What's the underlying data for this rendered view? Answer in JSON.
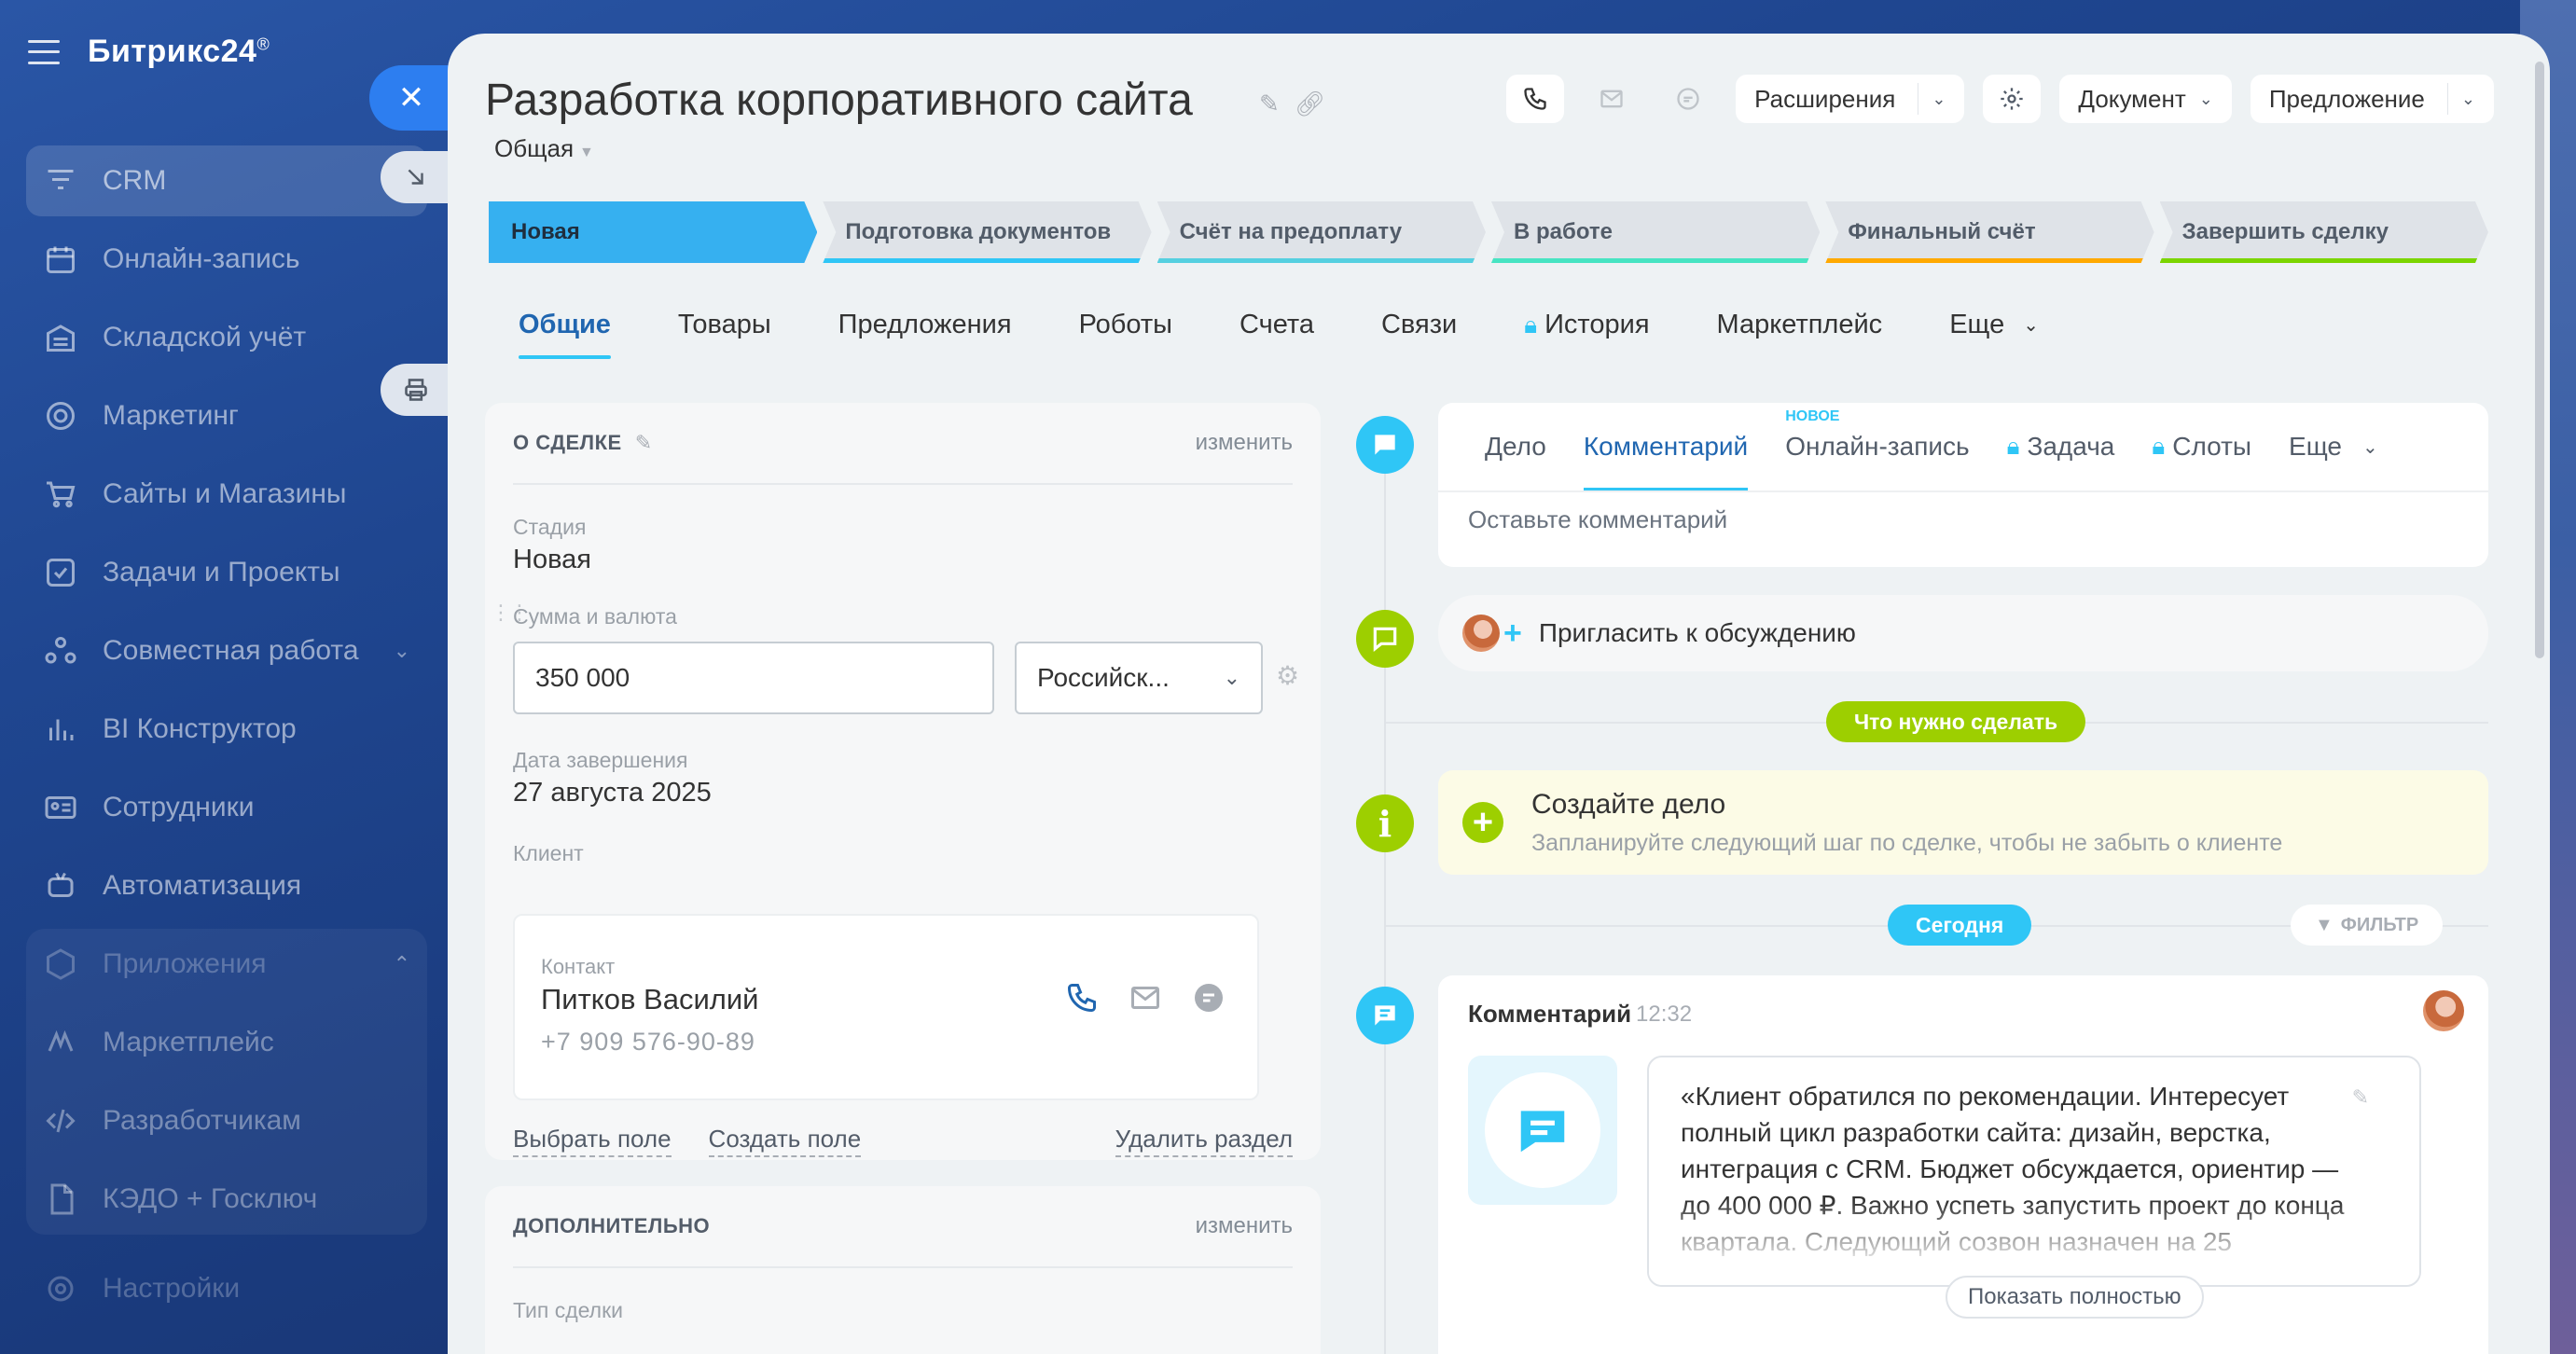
{
  "sidebar": {
    "brand": "Битрикс24",
    "brand_mark": "®",
    "items": [
      {
        "label": "CRM",
        "icon": "funnel-icon"
      },
      {
        "label": "Онлайн-запись",
        "icon": "calendar-icon"
      },
      {
        "label": "Складской учёт",
        "icon": "warehouse-icon"
      },
      {
        "label": "Маркетинг",
        "icon": "target-icon"
      },
      {
        "label": "Сайты и Магазины",
        "icon": "cart-icon"
      },
      {
        "label": "Задачи и Проекты",
        "icon": "checkbox-icon"
      },
      {
        "label": "Совместная работа",
        "icon": "collab-icon"
      },
      {
        "label": "BI Конструктор",
        "icon": "bar-chart-icon"
      },
      {
        "label": "Сотрудники",
        "icon": "id-card-icon"
      },
      {
        "label": "Автоматизация",
        "icon": "robot-icon"
      },
      {
        "label": "Приложения",
        "icon": "cube-icon"
      },
      {
        "label": "Маркетплейс",
        "icon": "market-icon"
      },
      {
        "label": "Разработчикам",
        "icon": "code-icon"
      },
      {
        "label": "КЭДО + Госключ",
        "icon": "document-icon"
      },
      {
        "label": "Настройки",
        "icon": "gear-icon"
      }
    ]
  },
  "deal": {
    "title": "Разработка корпоративного сайта",
    "category": "Общая"
  },
  "toolbar": {
    "extensions": "Расширения",
    "document": "Документ",
    "proposal": "Предложение"
  },
  "stages": [
    {
      "label": "Новая",
      "color": "#36b0f0"
    },
    {
      "label": "Подготовка документов",
      "color": "#2fc6f6"
    },
    {
      "label": "Счёт на предоплату",
      "color": "#55d0e0"
    },
    {
      "label": "В работе",
      "color": "#47e4c2"
    },
    {
      "label": "Финальный счёт",
      "color": "#ffa900"
    },
    {
      "label": "Завершить сделку",
      "color": "#7bd500"
    }
  ],
  "tabs": [
    "Общие",
    "Товары",
    "Предложения",
    "Роботы",
    "Счета",
    "Связи",
    "История",
    "Маркетплейс",
    "Еще"
  ],
  "about": {
    "header": "О СДЕЛКЕ",
    "edit": "изменить",
    "stage_label": "Стадия",
    "stage_value": "Новая",
    "amount_label": "Сумма и валюта",
    "amount_value": "350 000",
    "currency_value": "Российск...",
    "close_label": "Дата завершения",
    "close_value": "27 августа 2025",
    "client_label": "Клиент",
    "contact_kind": "Контакт",
    "contact_name": "Питков Василий",
    "contact_phone": "+7 909 576-90-89",
    "link_select": "Выбрать поле",
    "link_create": "Создать поле",
    "link_delete": "Удалить раздел"
  },
  "extra": {
    "header": "ДОПОЛНИТЕЛЬНО",
    "edit": "изменить",
    "type_label": "Тип сделки"
  },
  "editor": {
    "tabs": [
      "Дело",
      "Комментарий",
      "Онлайн-запись",
      "Задача",
      "Слоты",
      "Еще"
    ],
    "new_badge": "НОВОЕ",
    "placeholder": "Оставьте комментарий"
  },
  "timeline": {
    "invite": "Пригласить к обсуждению",
    "todo_pill": "Что нужно сделать",
    "todo_title": "Создайте дело",
    "todo_hint": "Запланируйте следующий шаг по сделке, чтобы не забыть о клиенте",
    "today_pill": "Сегодня",
    "filter": "ФИЛЬТР",
    "comment_header": "Комментарий",
    "comment_time": "12:32",
    "comment_text": "«Клиент обратился по рекомендации. Интересует полный цикл разработки сайта: дизайн, верстка, интеграция с CRM. Бюджет обсуждается, ориентир — до 400 000 ₽. Важно успеть запустить проект до конца квартала. Следующий созвон назначен на 25",
    "show_all": "Показать полностью"
  },
  "colors": {
    "accent": "#2fc6f6",
    "primary_blue": "#2d7ef0",
    "green": "#9dcf00"
  }
}
